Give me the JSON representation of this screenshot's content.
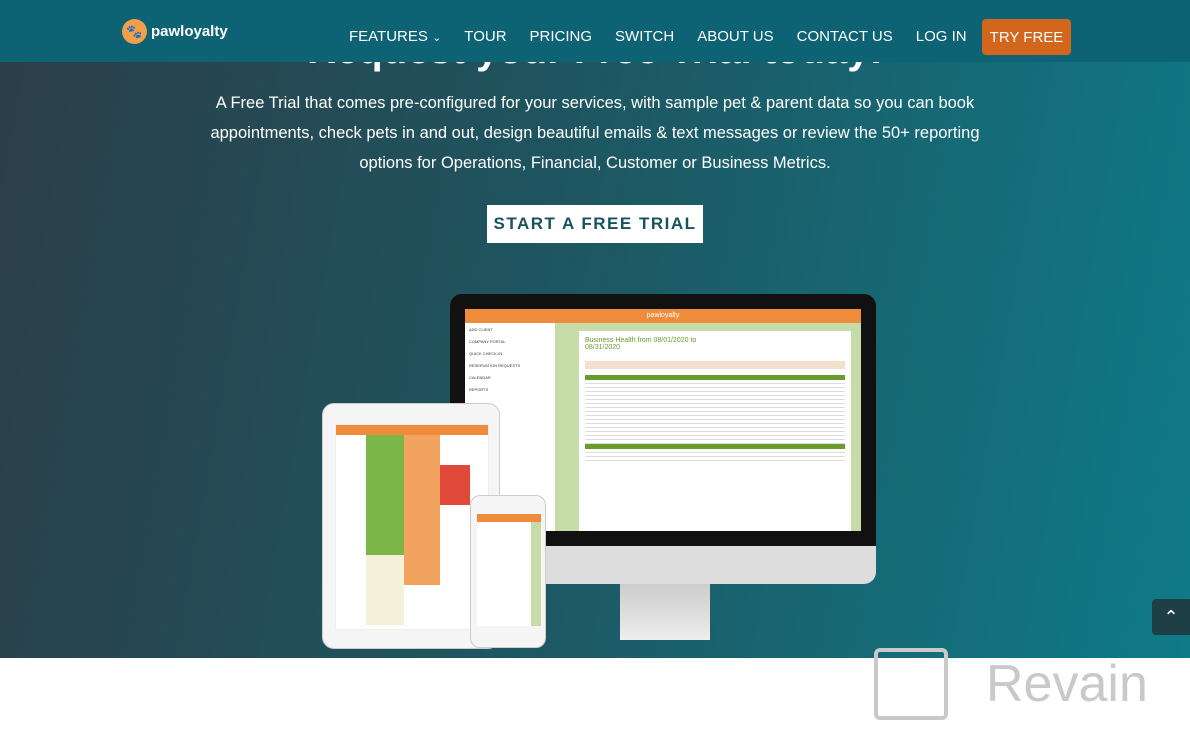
{
  "nav": {
    "logo_text": "pawloyalty",
    "items": [
      "FEATURES",
      "TOUR",
      "PRICING",
      "SWITCH",
      "ABOUT US",
      "CONTACT US",
      "LOG IN"
    ],
    "features_chevron": "chevron-down-icon",
    "cta": "TRY FREE",
    "cta_color": "#d1661c",
    "bg_color": "#0d6274"
  },
  "hero": {
    "title": "Request your Free Trial today!",
    "description": "A Free Trial that comes pre-configured for your services, with sample pet & parent data so you can book appointments, check pets in and out, design beautiful emails & text messages or review the 50+ reporting options for Operations, Financial, Customer or Business Metrics.",
    "button": "START A FREE TRIAL"
  },
  "mockup": {
    "app_logo": "pawloyalty",
    "report_title": "Business Health from 08/01/2020 to 08/31/2020",
    "sidebar": [
      "ADD CLIENT",
      "COMPANY PORTAL",
      "QUICK CHECK-IN",
      "RESERVATION REQUESTS",
      "CALENDAR",
      "REPORTS"
    ]
  },
  "watermark": "Revain",
  "scroll_top_icon": "chevron-up-icon"
}
